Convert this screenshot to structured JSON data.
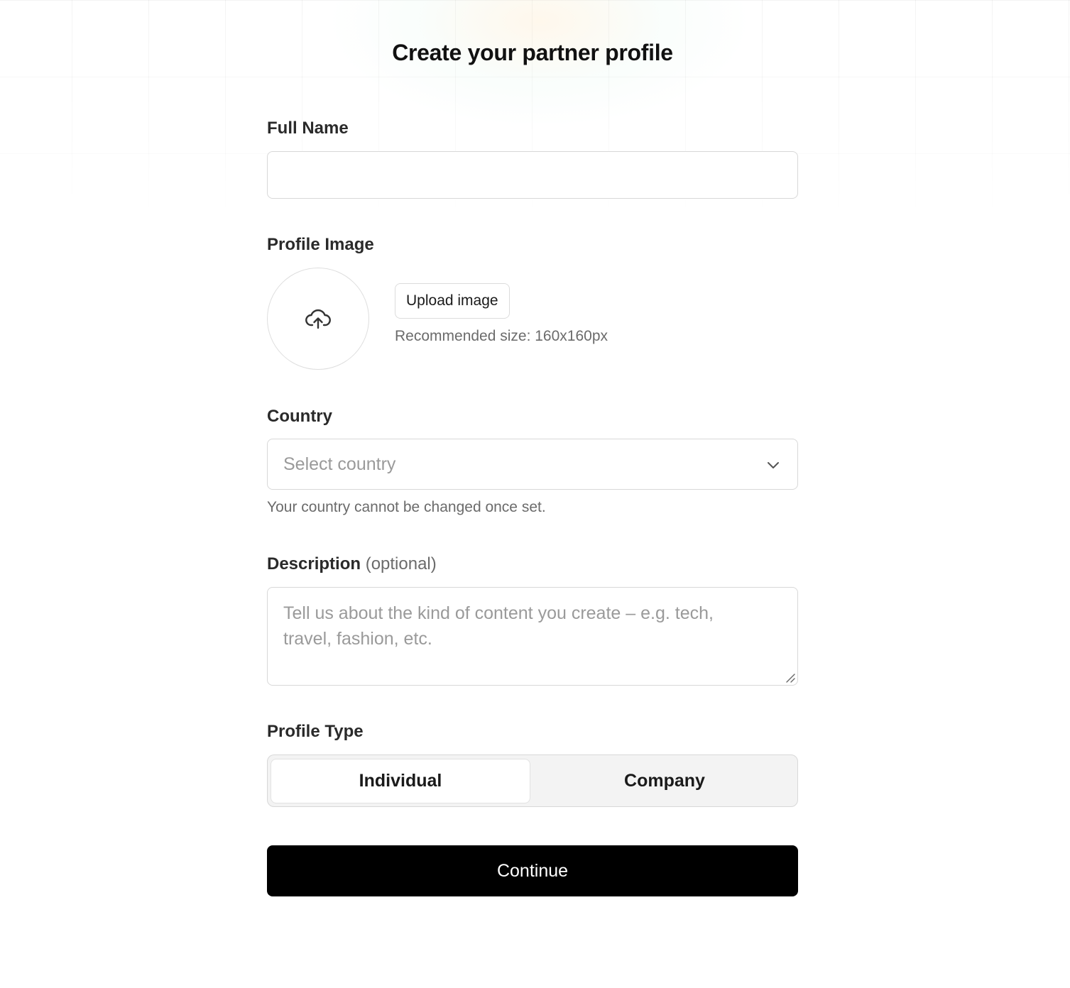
{
  "page": {
    "title": "Create your partner profile"
  },
  "form": {
    "full_name": {
      "label": "Full Name",
      "value": ""
    },
    "profile_image": {
      "label": "Profile Image",
      "upload_label": "Upload image",
      "hint": "Recommended size: 160x160px",
      "icon": "cloud-upload-icon"
    },
    "country": {
      "label": "Country",
      "placeholder": "Select country",
      "hint": "Your country cannot be changed once set.",
      "icon": "chevron-down-icon"
    },
    "description": {
      "label": "Description",
      "optional": "(optional)",
      "placeholder": "Tell us about the kind of content you create – e.g. tech, travel, fashion, etc."
    },
    "profile_type": {
      "label": "Profile Type",
      "options": [
        "Individual",
        "Company"
      ],
      "selected": "Individual"
    },
    "continue_label": "Continue"
  },
  "colors": {
    "primary_button": "#000000",
    "border": "#d8d8d8",
    "placeholder": "#9a9a9a",
    "hint_text": "#6b6b6b"
  }
}
